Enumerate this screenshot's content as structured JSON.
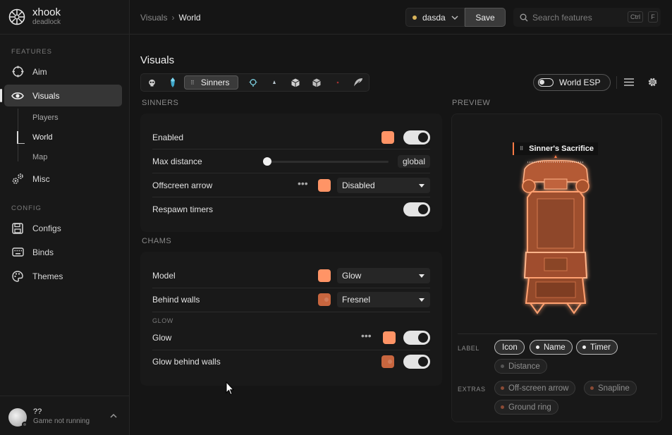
{
  "brand": {
    "name": "xhook",
    "sub": "deadlock"
  },
  "sidebar": {
    "features_label": "FEATURES",
    "config_label": "CONFIG",
    "items": [
      {
        "label": "Aim",
        "icon": "crosshair-icon"
      },
      {
        "label": "Visuals",
        "icon": "eye-icon",
        "active": true
      },
      {
        "label": "Misc",
        "icon": "gears-icon"
      },
      {
        "label": "Configs",
        "icon": "save-icon"
      },
      {
        "label": "Binds",
        "icon": "keyboard-icon"
      },
      {
        "label": "Themes",
        "icon": "palette-icon"
      }
    ],
    "sub_items": [
      "Players",
      "World",
      "Map"
    ]
  },
  "user": {
    "name": "??",
    "status": "Game not running"
  },
  "breadcrumb": {
    "parent": "Visuals",
    "current": "World"
  },
  "profile": {
    "name": "dasda"
  },
  "save_label": "Save",
  "search": {
    "placeholder": "Search features",
    "key1": "Ctrl",
    "key2": "F"
  },
  "page": {
    "title": "Visuals"
  },
  "tabs": {
    "active_label": "Sinners"
  },
  "esp_toggle_label": "World ESP",
  "sinners": {
    "heading": "SINNERS",
    "enabled": "Enabled",
    "max_distance": "Max distance",
    "max_distance_value": "global",
    "offscreen_arrow": "Offscreen arrow",
    "offscreen_value": "Disabled",
    "respawn_timers": "Respawn timers"
  },
  "chams": {
    "heading": "CHAMS",
    "model": "Model",
    "model_value": "Glow",
    "behind_walls": "Behind walls",
    "behind_walls_value": "Fresnel",
    "glow_section": "GLOW",
    "glow": "Glow",
    "glow_behind_walls": "Glow behind walls"
  },
  "preview": {
    "heading": "PREVIEW",
    "esp_name": "Sinner's Sacrifice",
    "label_heading": "LABEL",
    "extras_heading": "EXTRAS",
    "label_chips": [
      "Icon",
      "Name",
      "Timer",
      "Distance"
    ],
    "extra_chips": [
      "Off-screen arrow",
      "Snapline",
      "Ground ring"
    ]
  },
  "colors": {
    "accent": "#ff9466",
    "accent_dark": "#c8663f",
    "bg": "#151515"
  }
}
